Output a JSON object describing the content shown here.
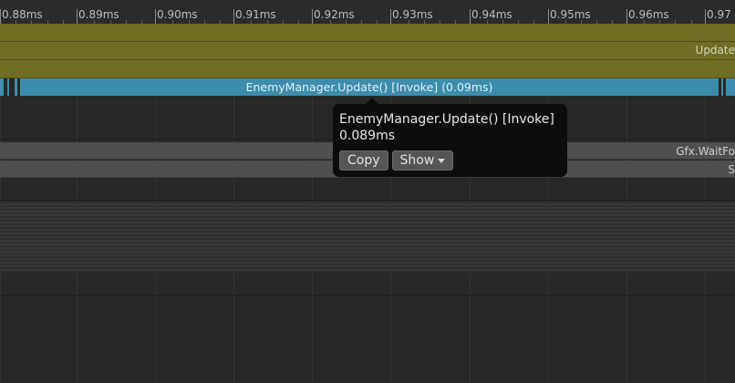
{
  "ruler": {
    "labels": [
      "0.88ms",
      "0.89ms",
      "0.90ms",
      "0.91ms",
      "0.92ms",
      "0.93ms",
      "0.94ms",
      "0.95ms",
      "0.96ms",
      "0.97"
    ]
  },
  "tracks": {
    "olive_row_2_label": "Update",
    "blue_bar_label": "EnemyManager.Update() [Invoke] (0.09ms)",
    "gray_row_1_label": "Gfx.WaitFo",
    "gray_row_2_label": "S"
  },
  "tooltip": {
    "name": "EnemyManager.Update() [Invoke]",
    "duration": "0.089ms",
    "copy_label": "Copy",
    "show_label": "Show"
  },
  "colors": {
    "background": "#282828",
    "olive_bar": "#6f6d24",
    "blue_bar": "#3b8cad",
    "gray_bar": "#4f4f4f",
    "tooltip_bg": "#0d0d0d"
  }
}
